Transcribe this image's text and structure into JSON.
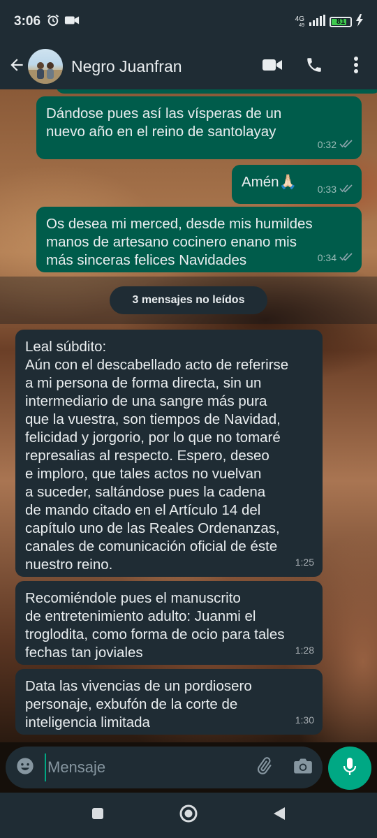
{
  "status_bar": {
    "time": "3:06",
    "network": "4G",
    "network_sub": "49",
    "battery": "81",
    "battery_level": 0.81,
    "battery_color": "#3fc94f"
  },
  "header": {
    "contact_name": "Negro Juanfran",
    "icons": [
      "back-arrow-icon",
      "video-call-icon",
      "phone-icon",
      "more-vert-icon"
    ]
  },
  "messages": [
    {
      "direction": "out",
      "text": "Dándose pues así las vísperas de un\nnuevo año en el reino de santolayay",
      "time": "0:32",
      "status": "read"
    },
    {
      "direction": "out",
      "text": "Amén🙏🏻",
      "time": "0:33",
      "status": "read"
    },
    {
      "direction": "out",
      "text": "Os desea mi merced, desde mis humildes\nmanos de artesano cocinero enano mis\nmás sinceras felices Navidades",
      "time": "0:34",
      "status": "read"
    },
    {
      "direction": "in",
      "text": "Leal súbdito:\nAún con el descabellado acto de referirse\na mi persona de forma directa, sin un\nintermediario de una sangre más pura\nque la vuestra, son tiempos de Navidad,\nfelicidad y jorgorio, por lo que no tomaré\nrepresalias al respecto. Espero, deseo\ne imploro, que tales actos no vuelvan\na suceder, saltándose pues la cadena\nde mando citado en el Artículo 14 del\ncapítulo uno de las Reales Ordenanzas,\ncanales de comunicación oficial de éste\nnuestro reino.",
      "time": "1:25"
    },
    {
      "direction": "in",
      "text": "Recomiéndole pues el manuscrito\nde entretenimiento adulto: Juanmi el\ntroglodita, como forma de ocio para tales\nfechas tan joviales",
      "time": "1:28"
    },
    {
      "direction": "in",
      "text": "Data las vivencias de un pordiosero\npersonaje, exbufón de la corte de\ninteligencia limitada",
      "time": "1:30"
    }
  ],
  "unread_banner": "3 mensajes no leídos",
  "composer": {
    "placeholder": "Mensaje",
    "icons": [
      "emoji-icon",
      "attach-icon",
      "camera-icon",
      "mic-icon"
    ]
  },
  "colors": {
    "outgoing_bubble": "#005c4b",
    "incoming_bubble": "#1f2c34",
    "header": "#1f2c34",
    "accent": "#00a884",
    "read_ticks": "#8696a0"
  }
}
